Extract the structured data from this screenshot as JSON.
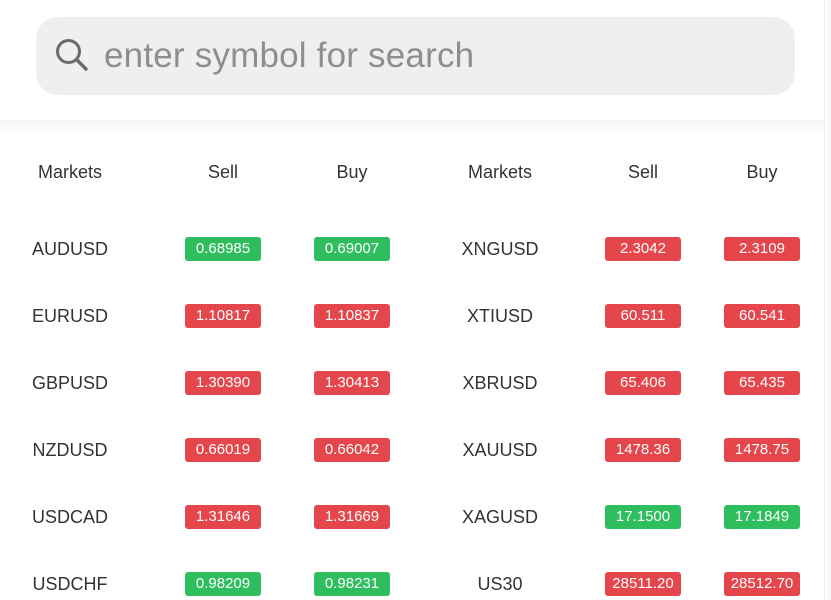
{
  "colors": {
    "up": "#2fbe5e",
    "down": "#e5464c"
  },
  "search": {
    "icon": "search-icon",
    "placeholder": "enter symbol for search"
  },
  "headers": {
    "left": {
      "markets": "Markets",
      "sell": "Sell",
      "buy": "Buy"
    },
    "right": {
      "markets": "Markets",
      "sell": "Sell",
      "buy": "Buy"
    }
  },
  "rows": [
    {
      "left": {
        "symbol": "AUDUSD",
        "sell": "0.68985",
        "buy": "0.69007",
        "direction": "up"
      },
      "right": {
        "symbol": "XNGUSD",
        "sell": "2.3042",
        "buy": "2.3109",
        "direction": "down"
      }
    },
    {
      "left": {
        "symbol": "EURUSD",
        "sell": "1.10817",
        "buy": "1.10837",
        "direction": "down"
      },
      "right": {
        "symbol": "XTIUSD",
        "sell": "60.511",
        "buy": "60.541",
        "direction": "down"
      }
    },
    {
      "left": {
        "symbol": "GBPUSD",
        "sell": "1.30390",
        "buy": "1.30413",
        "direction": "down"
      },
      "right": {
        "symbol": "XBRUSD",
        "sell": "65.406",
        "buy": "65.435",
        "direction": "down"
      }
    },
    {
      "left": {
        "symbol": "NZDUSD",
        "sell": "0.66019",
        "buy": "0.66042",
        "direction": "down"
      },
      "right": {
        "symbol": "XAUUSD",
        "sell": "1478.36",
        "buy": "1478.75",
        "direction": "down"
      }
    },
    {
      "left": {
        "symbol": "USDCAD",
        "sell": "1.31646",
        "buy": "1.31669",
        "direction": "down"
      },
      "right": {
        "symbol": "XAGUSD",
        "sell": "17.1500",
        "buy": "17.1849",
        "direction": "up"
      }
    },
    {
      "left": {
        "symbol": "USDCHF",
        "sell": "0.98209",
        "buy": "0.98231",
        "direction": "up"
      },
      "right": {
        "symbol": "US30",
        "sell": "28511.20",
        "buy": "28512.70",
        "direction": "down"
      }
    }
  ]
}
